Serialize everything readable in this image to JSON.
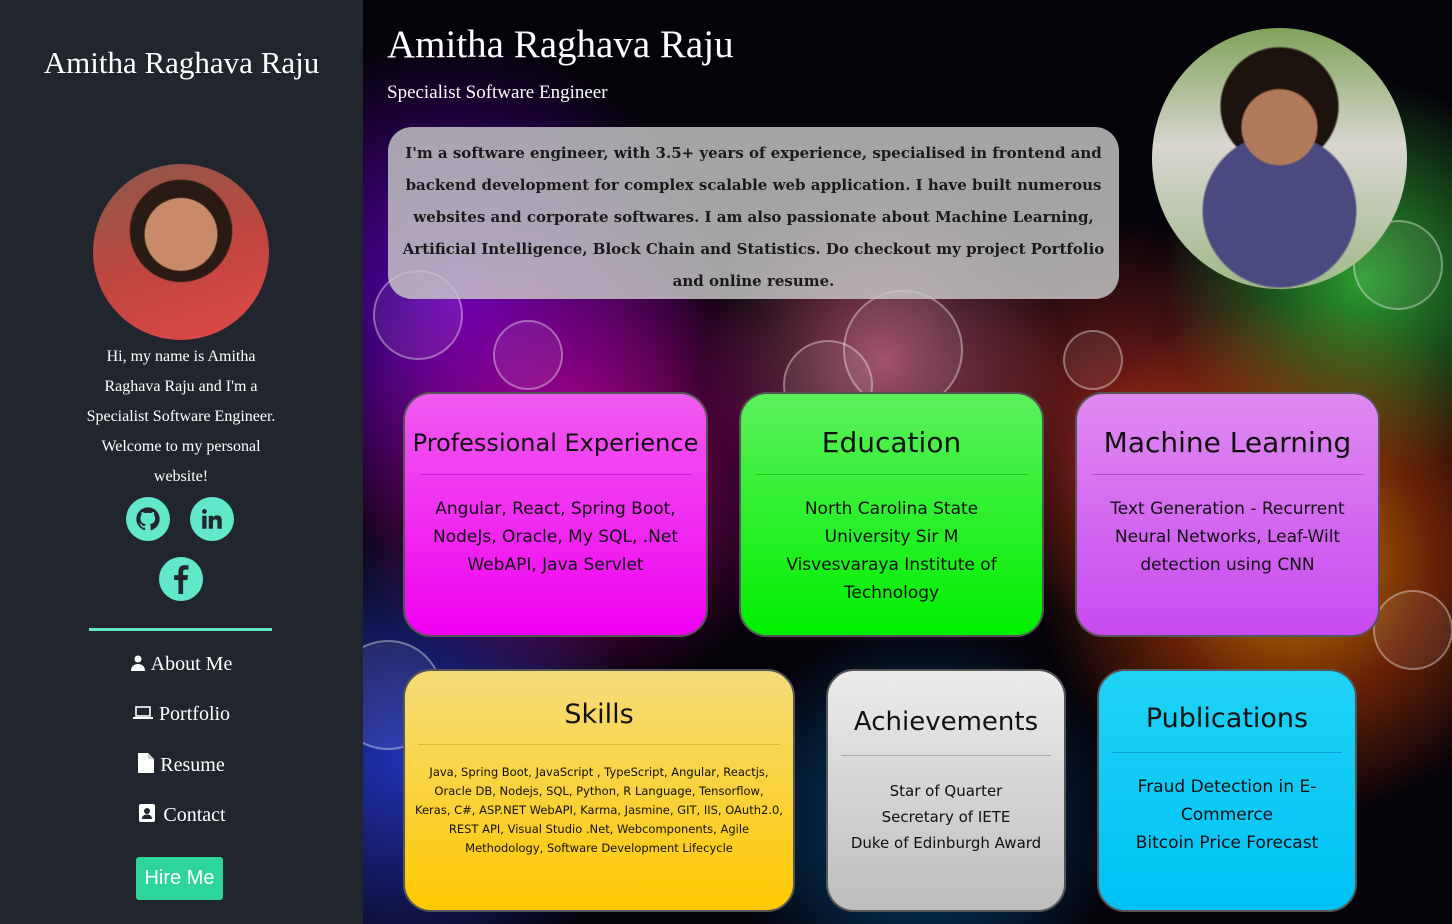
{
  "sidebar": {
    "name": "Amitha Raghava Raju",
    "bio": "Hi, my name is Amitha Raghava Raju and I'm a Specialist Software Engineer. Welcome to my personal website!",
    "nav": [
      {
        "label": "About Me",
        "icon": "user-icon"
      },
      {
        "label": "Portfolio",
        "icon": "laptop-icon"
      },
      {
        "label": "Resume",
        "icon": "file-icon"
      },
      {
        "label": "Contact",
        "icon": "contact-card-icon"
      }
    ],
    "hire_label": "Hire Me",
    "social": [
      "github-icon",
      "linkedin-icon",
      "facebook-icon"
    ]
  },
  "header": {
    "title": "Amitha Raghava Raju",
    "subtitle": "Specialist Software Engineer",
    "intro": "I'm a software engineer, with 3.5+ years of experience, specialised in frontend and backend development for complex scalable web application. I have built numerous websites and corporate softwares. I am also passionate about Machine Learning, Artificial Intelligence, Block Chain and Statistics. Do checkout my project Portfolio and online resume."
  },
  "cards": {
    "professional": {
      "title": "Professional Experience",
      "body": "Angular, React, Spring Boot, NodeJs, Oracle, My SQL, .Net WebAPI, Java Servlet"
    },
    "education": {
      "title": "Education",
      "body": "North Carolina State University Sir M Visvesvaraya Institute of Technology"
    },
    "ml": {
      "title": "Machine Learning",
      "body": "Text Generation - Recurrent Neural Networks, Leaf-Wilt detection using CNN"
    },
    "skills": {
      "title": "Skills",
      "body": "Java, Spring Boot, JavaScript , TypeScript, Angular, Reactjs, Oracle DB, Nodejs, SQL, Python, R Language, Tensorflow, Keras, C#, ASP.NET WebAPI, Karma, Jasmine, GIT, IIS, OAuth2.0, REST API, Visual Studio .Net, Webcomponents, Agile Methodology, Software Development Lifecycle"
    },
    "achievements": {
      "title": "Achievements",
      "items": [
        "Star of Quarter",
        "Secretary of IETE",
        "Duke of Edinburgh Award"
      ]
    },
    "publications": {
      "title": "Publications",
      "items": [
        "Fraud Detection in E-Commerce",
        "Bitcoin Price Forecast"
      ]
    }
  },
  "colors": {
    "sidebar_bg": "#21262e",
    "accent": "#62e8c8",
    "hire_button": "#2ed59a",
    "card_professional": "#f000f0",
    "card_education": "#00f000",
    "card_ml": "#c84af0",
    "card_skills": "#ffc900",
    "card_achievements": "#bdbdbd",
    "card_publications": "#00c2f5"
  }
}
